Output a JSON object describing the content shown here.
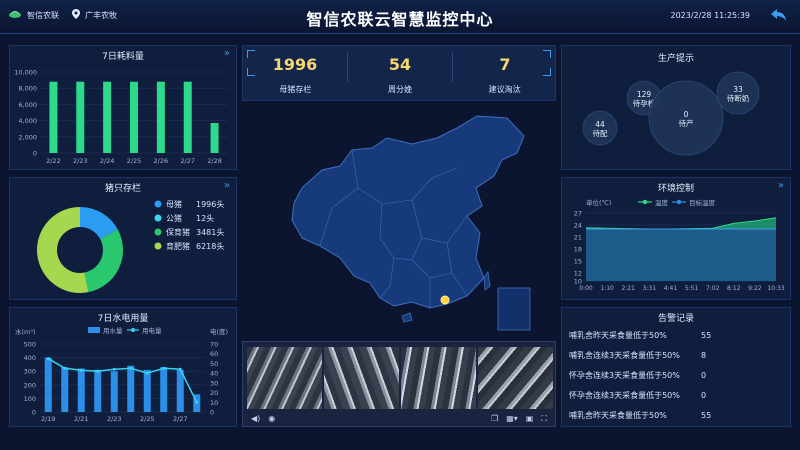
{
  "header": {
    "logo_text": "智信农联",
    "location": "广丰农牧",
    "title": "智信农联云智慧监控中心",
    "datetime": "2023/2/28 11:25:39"
  },
  "stats": [
    {
      "value": "1996",
      "label": "母猪存栏"
    },
    {
      "value": "54",
      "label": "周分娩"
    },
    {
      "value": "7",
      "label": "建议淘汰"
    }
  ],
  "feed_panel": {
    "title": "7日耗料量"
  },
  "stock_panel": {
    "title": "猪只存栏"
  },
  "water_panel": {
    "title": "7日水电用量",
    "left_unit": "水(m³)",
    "right_unit": "电(度)",
    "legend_water": "用水量",
    "legend_power": "用电量"
  },
  "production_panel": {
    "title": "生产提示"
  },
  "env_panel": {
    "title": "环境控制",
    "unit": "单位(℃)",
    "legend_temp": "温度",
    "legend_target": "目标温度"
  },
  "alarm_panel": {
    "title": "告警记录",
    "rows": [
      {
        "text": "哺乳舍昨天采食量低于50%",
        "value": "55"
      },
      {
        "text": "哺乳舍连续3天采食量低于50%",
        "value": "8"
      },
      {
        "text": "怀孕舍连续3天采食量低于50%",
        "value": "0"
      },
      {
        "text": "怀孕舍连续3天采食量低于50%",
        "value": "0"
      },
      {
        "text": "哺乳舍昨天采食量低于50%",
        "value": "55"
      }
    ]
  },
  "chart_data": [
    {
      "type": "bar",
      "title": "7日耗料量",
      "categories": [
        "2/22",
        "2/23",
        "2/24",
        "2/25",
        "2/26",
        "2/27",
        "2/28"
      ],
      "values": [
        8800,
        8800,
        8800,
        8800,
        8800,
        8800,
        3700
      ],
      "ylim": [
        0,
        10000
      ],
      "yticks": [
        "0",
        "2,000",
        "4,000",
        "6,000",
        "8,000",
        "10,000"
      ],
      "color": "#2fd98c"
    },
    {
      "type": "pie",
      "title": "猪只存栏",
      "labels": [
        "母猪",
        "公猪",
        "保育猪",
        "育肥猪"
      ],
      "values": [
        1996,
        12,
        3481,
        6218
      ],
      "display": [
        "1996头",
        "12头",
        "3481头",
        "6218头"
      ],
      "colors": [
        "#2b9cf0",
        "#3ad6f2",
        "#29c86e",
        "#a6d84f"
      ]
    },
    {
      "type": "bar",
      "title": "7日水电用量",
      "categories": [
        "2/19",
        "2/20",
        "2/21",
        "2/22",
        "2/23",
        "2/24",
        "2/25",
        "2/26",
        "2/27",
        "2/28"
      ],
      "x_tick_labels": [
        "2/19",
        "2/21",
        "2/23",
        "2/25",
        "2/27"
      ],
      "series": [
        {
          "name": "用水量",
          "type": "bar",
          "values": [
            400,
            330,
            320,
            310,
            300,
            340,
            310,
            330,
            310,
            130
          ]
        },
        {
          "name": "用电量",
          "type": "line",
          "values": [
            55,
            45,
            43,
            42,
            44,
            45,
            40,
            45,
            44,
            10
          ]
        }
      ],
      "ylim_left": [
        0,
        500
      ],
      "yticks_left": [
        "0",
        "100",
        "200",
        "300",
        "400",
        "500"
      ],
      "ylim_right": [
        0,
        70
      ],
      "yticks_right": [
        "0",
        "10",
        "20",
        "30",
        "40",
        "50",
        "60",
        "70"
      ]
    },
    {
      "type": "scatter",
      "title": "生产提示",
      "points": [
        {
          "label": "待配",
          "value": 44
        },
        {
          "label": "待孕检",
          "value": 129
        },
        {
          "label": "待产",
          "value": 0
        },
        {
          "label": "待断奶",
          "value": 33
        }
      ]
    },
    {
      "type": "area",
      "title": "环境控制",
      "x": [
        "0:00",
        "1:10",
        "2:21",
        "3:31",
        "4:41",
        "5:51",
        "7:02",
        "8:12",
        "9:22",
        "10:33"
      ],
      "series": [
        {
          "name": "温度",
          "values": [
            23.3,
            23.2,
            23.1,
            23.0,
            23.0,
            23.1,
            23.2,
            24.4,
            25.0,
            25.8
          ]
        },
        {
          "name": "目标温度",
          "values": [
            23.0,
            23.0,
            23.0,
            23.0,
            23.0,
            23.0,
            23.0,
            23.0,
            23.0,
            23.0
          ]
        }
      ],
      "ylim": [
        10,
        27
      ],
      "yticks": [
        "10",
        "12",
        "15",
        "18",
        "21",
        "24",
        "27"
      ]
    }
  ]
}
